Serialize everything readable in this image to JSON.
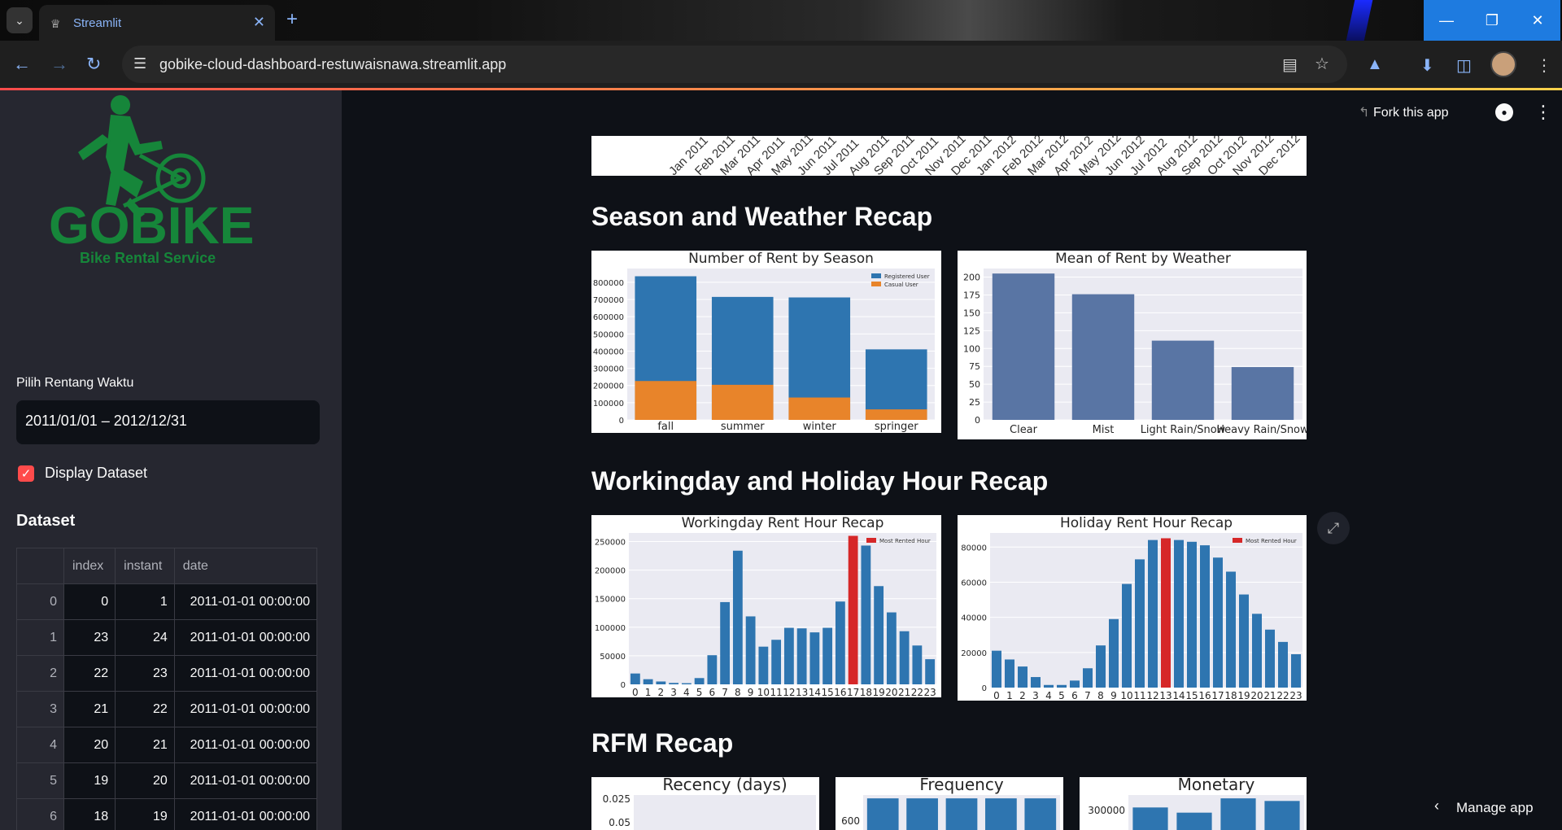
{
  "browser": {
    "tab_title": "Streamlit",
    "url": "gobike-cloud-dashboard-restuwaisnawa.streamlit.app"
  },
  "header": {
    "fork_label": "Fork this app"
  },
  "sidebar": {
    "logo_text": "GOBIKE",
    "logo_subtitle": "Bike Rental Service",
    "date_label": "Pilih Rentang Waktu",
    "date_value": "2011/01/01 – 2012/12/31",
    "checkbox_label": "Display Dataset",
    "dataset_title": "Dataset",
    "table": {
      "columns": [
        "",
        "index",
        "instant",
        "date"
      ],
      "rows": [
        [
          "0",
          "0",
          "1",
          "2011-01-01 00:00:00"
        ],
        [
          "1",
          "23",
          "24",
          "2011-01-01 00:00:00"
        ],
        [
          "2",
          "22",
          "23",
          "2011-01-01 00:00:00"
        ],
        [
          "3",
          "21",
          "22",
          "2011-01-01 00:00:00"
        ],
        [
          "4",
          "20",
          "21",
          "2011-01-01 00:00:00"
        ],
        [
          "5",
          "19",
          "20",
          "2011-01-01 00:00:00"
        ],
        [
          "6",
          "18",
          "19",
          "2011-01-01 00:00:00"
        ]
      ]
    }
  },
  "main": {
    "top_ticks": [
      "Jan 2011",
      "Feb 2011",
      "Mar 2011",
      "Apr 2011",
      "May 2011",
      "Jun 2011",
      "Jul 2011",
      "Aug 2011",
      "Sep 2011",
      "Oct 2011",
      "Nov 2011",
      "Dec 2011",
      "Jan 2012",
      "Feb 2012",
      "Mar 2012",
      "Apr 2012",
      "May 2012",
      "Jun 2012",
      "Jul 2012",
      "Aug 2012",
      "Sep 2012",
      "Oct 2012",
      "Nov 2012",
      "Dec 2012"
    ],
    "sections": {
      "season": "Season and Weather Recap",
      "hour": "Workingday and Holiday Hour Recap",
      "rfm": "RFM Recap"
    },
    "manage_app": "Manage app"
  },
  "colors": {
    "blue": "#2e75b0",
    "orange": "#e8842a",
    "slate": "#5975a4",
    "red": "#d62728",
    "grid_bg": "#eaeaf2"
  },
  "chart_data": [
    {
      "type": "bar",
      "title": "Number of Rent by Season",
      "categories": [
        "fall",
        "summer",
        "winter",
        "springer"
      ],
      "series": [
        {
          "name": "Registered User",
          "values": [
            835000,
            715000,
            712000,
            410000
          ]
        },
        {
          "name": "Casual User",
          "values": [
            226000,
            204000,
            130000,
            61000
          ]
        }
      ],
      "stacked": false,
      "ylim": [
        0,
        880000
      ],
      "yticks": [
        0,
        100000,
        200000,
        300000,
        400000,
        500000,
        600000,
        700000,
        800000
      ],
      "legend": "top-right"
    },
    {
      "type": "bar",
      "title": "Mean of Rent by Weather",
      "categories": [
        "Clear",
        "Mist",
        "Light Rain/Snow",
        "Heavy Rain/Snow"
      ],
      "values": [
        205,
        176,
        111,
        74
      ],
      "ylim": [
        0,
        212
      ],
      "yticks": [
        0,
        25,
        50,
        75,
        100,
        125,
        150,
        175,
        200
      ]
    },
    {
      "type": "bar",
      "title": "Workingday Rent Hour Recap",
      "categories": [
        "0",
        "1",
        "2",
        "3",
        "4",
        "5",
        "6",
        "7",
        "8",
        "9",
        "10",
        "11",
        "12",
        "13",
        "14",
        "15",
        "16",
        "17",
        "18",
        "19",
        "20",
        "21",
        "22",
        "23"
      ],
      "values": [
        19000,
        9000,
        5000,
        2500,
        2000,
        11000,
        51000,
        144000,
        234000,
        119000,
        66000,
        78000,
        99000,
        98000,
        91000,
        99000,
        145000,
        260000,
        243000,
        172000,
        126000,
        93000,
        68000,
        44000
      ],
      "highlight_index": 17,
      "legend_entry": "Most Rented Hour",
      "ylim": [
        0,
        265000
      ],
      "yticks": [
        0,
        50000,
        100000,
        150000,
        200000,
        250000
      ]
    },
    {
      "type": "bar",
      "title": "Holiday Rent Hour Recap",
      "categories": [
        "0",
        "1",
        "2",
        "3",
        "4",
        "5",
        "6",
        "7",
        "8",
        "9",
        "10",
        "11",
        "12",
        "13",
        "14",
        "15",
        "16",
        "17",
        "18",
        "19",
        "20",
        "21",
        "22",
        "23"
      ],
      "values": [
        21000,
        16000,
        12000,
        6000,
        1500,
        1500,
        4000,
        11000,
        24000,
        39000,
        59000,
        73000,
        84000,
        85000,
        84000,
        83000,
        81000,
        74000,
        66000,
        53000,
        42000,
        33000,
        26000,
        19000
      ],
      "highlight_index": 13,
      "legend_entry": "Most Rented Hour",
      "ylim": [
        0,
        88000
      ],
      "yticks": [
        0,
        20000,
        40000,
        60000,
        80000
      ]
    },
    {
      "type": "bar",
      "title": "Recency (days)",
      "yticks": [
        0.025,
        0.05
      ]
    },
    {
      "type": "bar",
      "title": "Frequency",
      "values": [
        680,
        680,
        680,
        680,
        680
      ],
      "yticks": [
        600
      ]
    },
    {
      "type": "bar",
      "title": "Monetary",
      "values": [
        280000,
        240000,
        350000,
        330000
      ],
      "yticks": [
        300000
      ]
    }
  ]
}
